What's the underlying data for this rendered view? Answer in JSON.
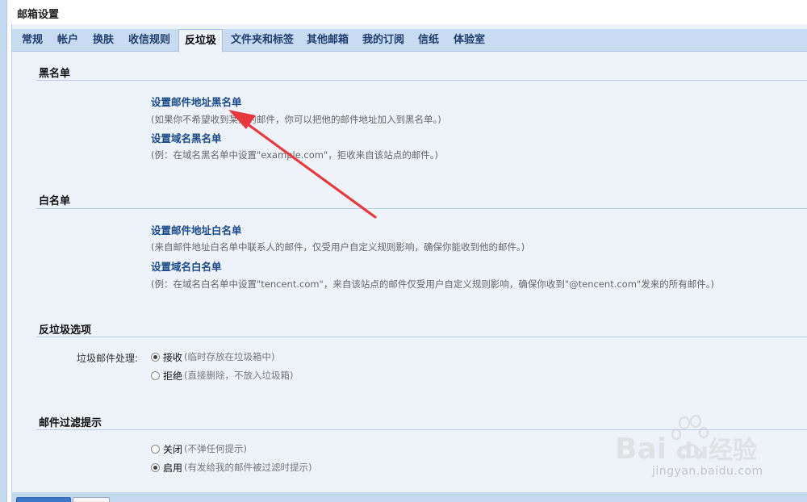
{
  "window": {
    "title": "邮箱设置"
  },
  "tabs": [
    {
      "label": "常规"
    },
    {
      "label": "帐户"
    },
    {
      "label": "换肤"
    },
    {
      "label": "收信规则"
    },
    {
      "label": "反垃圾",
      "active": true
    },
    {
      "label": "文件夹和标签"
    },
    {
      "label": "其他邮箱"
    },
    {
      "label": "我的订阅"
    },
    {
      "label": "信纸"
    },
    {
      "label": "体验室"
    }
  ],
  "blacklist": {
    "title": "黑名单",
    "address_link": "设置邮件地址黑名单",
    "address_desc": "(如果你不希望收到某人的邮件，你可以把他的邮件地址加入到黑名单。)",
    "domain_link": "设置域名黑名单",
    "domain_desc": "(例：在域名黑名单中设置\"example.com\"，拒收来自该站点的邮件。)"
  },
  "whitelist": {
    "title": "白名单",
    "address_link": "设置邮件地址白名单",
    "address_desc": "(来自邮件地址白名单中联系人的邮件，仅受用户自定义规则影响，确保你能收到他的邮件。)",
    "domain_link": "设置域名白名单",
    "domain_desc": "(例：在域名白名单中设置\"tencent.com\"，来自该站点的邮件仅受用户自定义规则影响，确保你收到\"@tencent.com\"发来的所有邮件。)"
  },
  "antispam": {
    "title": "反垃圾选项",
    "field_label": "垃圾邮件处理:",
    "options": [
      {
        "label": "接收",
        "hint": "(临时存放在垃圾箱中)",
        "checked": true
      },
      {
        "label": "拒绝",
        "hint": "(直接删除，不放入垃圾箱)",
        "checked": false
      }
    ]
  },
  "filter_notice": {
    "title": "邮件过滤提示",
    "options": [
      {
        "label": "关闭",
        "hint": "(不弹任何提示)",
        "checked": false
      },
      {
        "label": "启用",
        "hint": "(有发给我的邮件被过滤时提示)",
        "checked": true
      }
    ]
  },
  "watermark": {
    "text": "jingyan.baidu.com"
  },
  "colors": {
    "accent": "#1a4a8a",
    "tabbar": "#c8dcf1",
    "panel": "#eef3fa",
    "arrow": "#e8383d"
  }
}
